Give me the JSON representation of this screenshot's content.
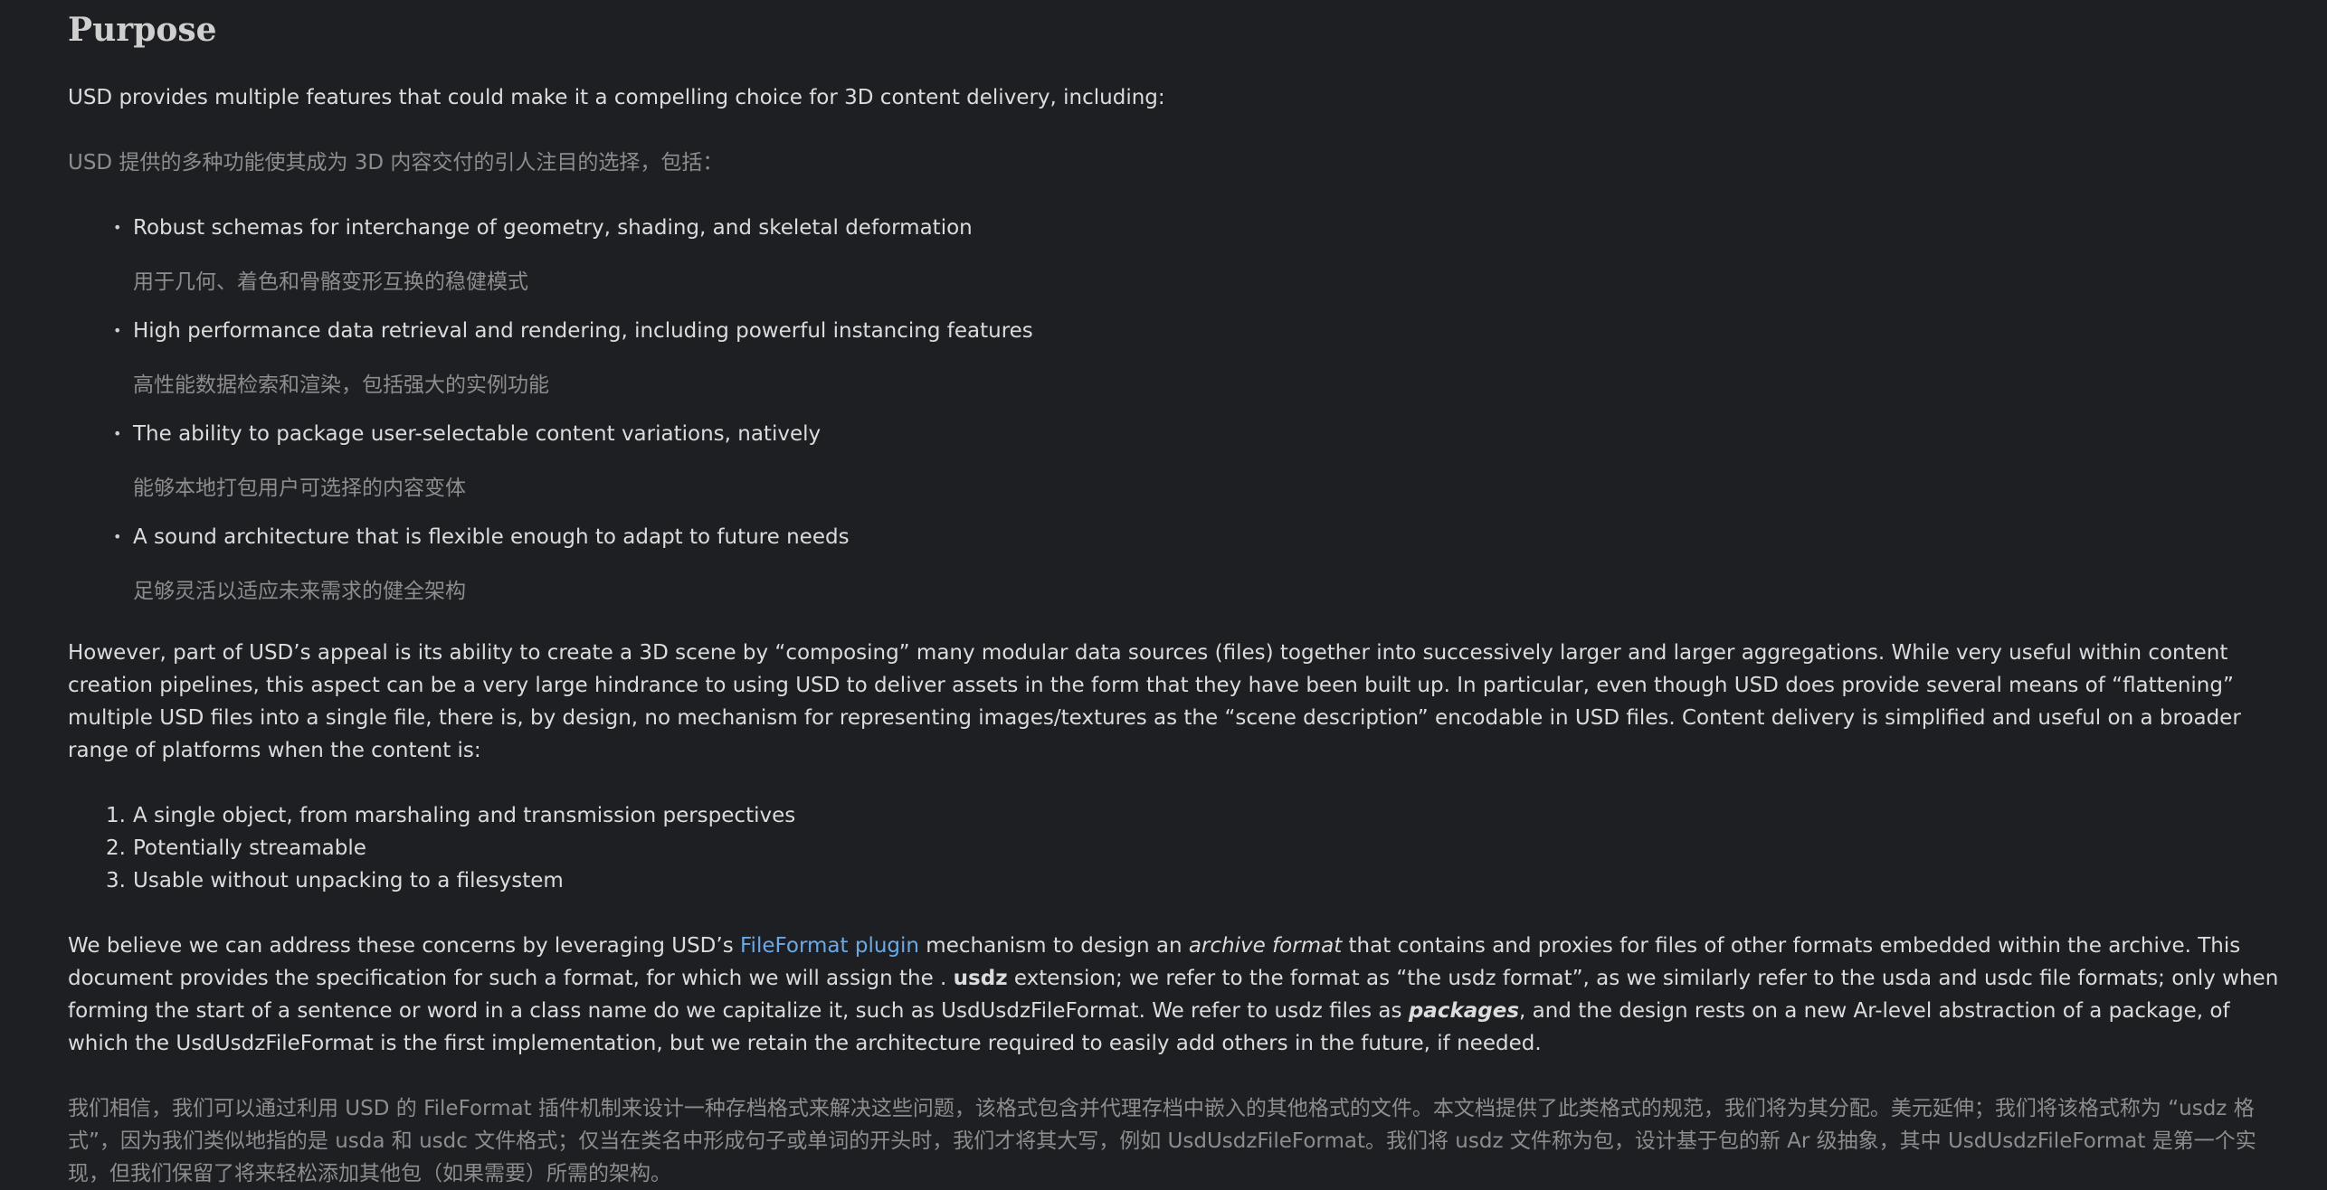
{
  "heading": "Purpose",
  "intro_en": "USD provides multiple features that could make it a compelling choice for 3D content delivery, including:",
  "intro_zh": "USD 提供的多种功能使其成为 3D 内容交付的引人注目的选择，包括：",
  "features": [
    {
      "en": "Robust schemas for interchange of geometry, shading, and skeletal deformation",
      "zh": "用于几何、着色和骨骼变形互换的稳健模式"
    },
    {
      "en": "High performance data retrieval and rendering, including powerful instancing features",
      "zh": "高性能数据检索和渲染，包括强大的实例功能"
    },
    {
      "en": "The ability to package user-selectable content variations, natively",
      "zh": "能够本地打包用户可选择的内容变体"
    },
    {
      "en": "A sound architecture that is flexible enough to adapt to future needs",
      "zh": "足够灵活以适应未来需求的健全架构"
    }
  ],
  "bullet_glyph": "•",
  "however_en": "However, part of USD’s appeal is its ability to create a 3D scene by “composing” many modular data sources (files) together into successively larger and larger aggregations. While very useful within content creation pipelines, this aspect can be a very large hindrance to using USD to deliver assets in the form that they have been built up. In particular, even though USD does provide several means of “flattening” multiple USD files into a single file, there is, by design, no mechanism for representing images/textures as the “scene description” encodable in USD files. Content delivery is simplified and useful on a broader range of platforms when the content is:",
  "properties": [
    {
      "num": "1.",
      "text": "A single object, from marshaling and transmission perspectives"
    },
    {
      "num": "2.",
      "text": "Potentially streamable"
    },
    {
      "num": "3.",
      "text": "Usable without unpacking to a filesystem"
    }
  ],
  "believe": {
    "part1": "We believe we can address these concerns by leveraging USD’s ",
    "link": "FileFormat plugin",
    "part2": " mechanism to design an ",
    "archive_format": "archive format",
    "part3": " that contains and proxies for files of other formats embedded within the archive. This document provides the specification for such a format, for which we will assign the . ",
    "usdz": "usdz",
    "part4": " extension; we refer to the format as “the usdz format”, as we similarly refer to the usda and usdc file formats; only when forming the start of a sentence or word in a class name do we capitalize it, such as UsdUsdzFileFormat. We refer to usdz files as ",
    "packages": "packages",
    "part5": ", and the design rests on a new Ar-level abstraction of a package, of which the UsdUsdzFileFormat is the first implementation, but we retain the architecture required to easily add others in the future, if needed."
  },
  "believe_zh": "我们相信，我们可以通过利用 USD 的 FileFormat 插件机制来设计一种存档格式来解决这些问题，该格式包含并代理存档中嵌入的其他格式的文件。本文档提供了此类格式的规范，我们将为其分配。美元延伸；我们将该格式称为 “usdz 格式”，因为我们类似地指的是 usda 和 usdc 文件格式；仅当在类名中形成句子或单词的开头时，我们才将其大写，例如 UsdUsdzFileFormat。我们将 usdz 文件称为包，设计基于包的新 Ar 级抽象，其中 UsdUsdzFileFormat 是第一个实现，但我们保留了将来轻松添加其他包（如果需要）所需的架构。",
  "colors": {
    "background": "#1e1f22",
    "text_en": "#dcdcdc",
    "text_zh": "#8d8d8d",
    "link": "#6aa9e8"
  }
}
